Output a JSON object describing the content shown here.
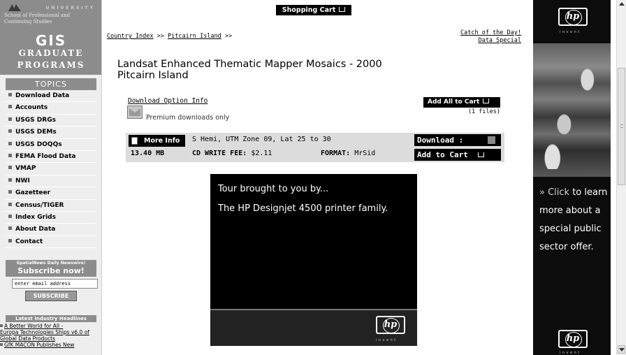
{
  "sidebar": {
    "logo": {
      "university": "UNIVERSITY",
      "school": "School of Professional and Continuing Studies",
      "gis": "GIS",
      "graduate": "Graduate",
      "programs": "Programs"
    },
    "topics_heading": "TOPICS",
    "topics": [
      "Download Data",
      "Accounts",
      "USGS DRGs",
      "USGS DEMs",
      "USGS DOQQs",
      "FEMA Flood Data",
      "VMAP",
      "NWI",
      "Gazetteer",
      "Census/TIGER",
      "Index Grids",
      "About Data",
      "Contact"
    ],
    "newswire": {
      "line1": "SpatialNews Daily Newswire!",
      "line2": "Subscribe now!",
      "email_value": "enter email address",
      "subscribe_label": "SUBSCRIBE"
    },
    "headlines_heading": "Latest Industry Headlines",
    "headlines": [
      "A Better World for All -",
      "Europa Technologies Ships v6.0 of Global Data Products",
      "GfK MACON Publishes New"
    ]
  },
  "main": {
    "cart_top": "Shopping Cart",
    "breadcrumb": [
      {
        "label": "Country Index",
        "link": true
      },
      {
        "label": " >> ",
        "link": false
      },
      {
        "label": "Pitcairn Island",
        "link": true
      },
      {
        "label": " >>",
        "link": false
      }
    ],
    "catch_of_day": "Catch of the Day!",
    "data_special": "Data Special",
    "title_line1": "Landsat Enhanced Thematic Mapper Mosaics - 2000",
    "title_line2": "Pitcairn Island",
    "download_option_info": "Download Option Info",
    "premium_text": "Premium downloads only",
    "add_all_label": "Add All to Cart",
    "files_count": "(1 files)",
    "item": {
      "more_info_label": "More Info",
      "description": "S Hemi, UTM Zone 09, Lat 25 to 30",
      "size": "13.40 MB",
      "fee_label": "CD WRITE FEE:",
      "fee_value": "$2.11",
      "format_label": "FORMAT:",
      "format_value": "MrSid",
      "download_label": "Download :",
      "add_to_cart_label": "Add to Cart"
    },
    "ad": {
      "line1": "Tour brought to you by...",
      "line2": "The HP Designjet 4500 printer family.",
      "logo_text": "hp",
      "invent": "invent"
    }
  },
  "right_ad": {
    "logo_text": "hp",
    "invent": "invent",
    "click": "» Click",
    "text_rest": "to learn more about a special public sector offer.",
    "bottom_logo_text": "hp",
    "bottom_invent": "invent"
  },
  "icons": {
    "cart": "shopping-cart-icon",
    "envelope": "envelope-icon",
    "document": "document-icon",
    "checkbox": "checkbox-icon"
  }
}
